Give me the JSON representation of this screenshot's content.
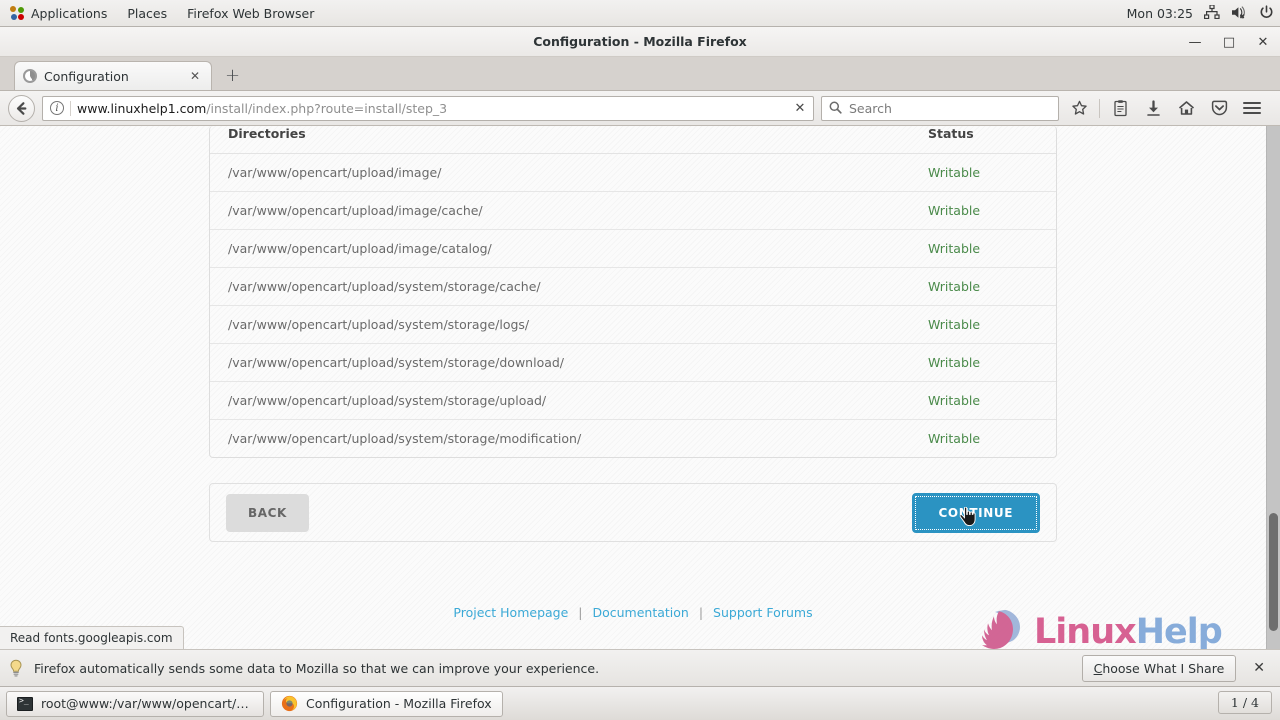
{
  "desktop": {
    "panel": {
      "menus": [
        "Applications",
        "Places",
        "Firefox Web Browser"
      ],
      "clock": "Mon 03:25",
      "tray_icons": [
        "network-icon",
        "volume-muted-icon",
        "power-icon"
      ]
    },
    "taskbar": {
      "items": [
        {
          "icon": "terminal-icon",
          "label": "root@www:/var/www/opencart/upl..."
        },
        {
          "icon": "firefox-icon",
          "label": "Configuration - Mozilla Firefox"
        }
      ],
      "workspace": "1 / 4"
    }
  },
  "browser": {
    "window_title": "Configuration - Mozilla Firefox",
    "window_buttons": {
      "minimize": "—",
      "maximize": "□",
      "close": "✕"
    },
    "tab": {
      "title": "Configuration",
      "close_label": "✕"
    },
    "new_tab_label": "+",
    "urlbar": {
      "host": "www.linuxhelp1.com",
      "path": "/install/index.php?route=install/step_3",
      "stop_label": "✕"
    },
    "search": {
      "placeholder": "Search"
    },
    "toolbar_icons": [
      "bookmark-star-icon",
      "reader-list-icon",
      "downloads-icon",
      "home-icon",
      "pocket-icon",
      "menu-hamburger-icon"
    ],
    "statusbar_text": "Read fonts.googleapis.com",
    "notification": {
      "text": "Firefox automatically sends some data to Mozilla so that we can improve your experience.",
      "button_label": "Choose What I Share",
      "button_accesskey": "C",
      "close_label": "✕"
    }
  },
  "page": {
    "table": {
      "headers": [
        "Directories",
        "Status"
      ],
      "rows": [
        {
          "directory": "/var/www/opencart/upload/image/",
          "status": "Writable"
        },
        {
          "directory": "/var/www/opencart/upload/image/cache/",
          "status": "Writable"
        },
        {
          "directory": "/var/www/opencart/upload/image/catalog/",
          "status": "Writable"
        },
        {
          "directory": "/var/www/opencart/upload/system/storage/cache/",
          "status": "Writable"
        },
        {
          "directory": "/var/www/opencart/upload/system/storage/logs/",
          "status": "Writable"
        },
        {
          "directory": "/var/www/opencart/upload/system/storage/download/",
          "status": "Writable"
        },
        {
          "directory": "/var/www/opencart/upload/system/storage/upload/",
          "status": "Writable"
        },
        {
          "directory": "/var/www/opencart/upload/system/storage/modification/",
          "status": "Writable"
        }
      ]
    },
    "buttons": {
      "back": "BACK",
      "continue": "CONTINUE"
    },
    "footer": {
      "links": [
        "Project Homepage",
        "Documentation",
        "Support Forums"
      ],
      "separator": "|"
    },
    "watermark": {
      "text_part1": "Linux",
      "text_part2": "Help"
    }
  },
  "colors": {
    "accent_blue": "#2b93c2",
    "status_green": "#4a8a4a",
    "link_blue": "#3ba9d6"
  }
}
